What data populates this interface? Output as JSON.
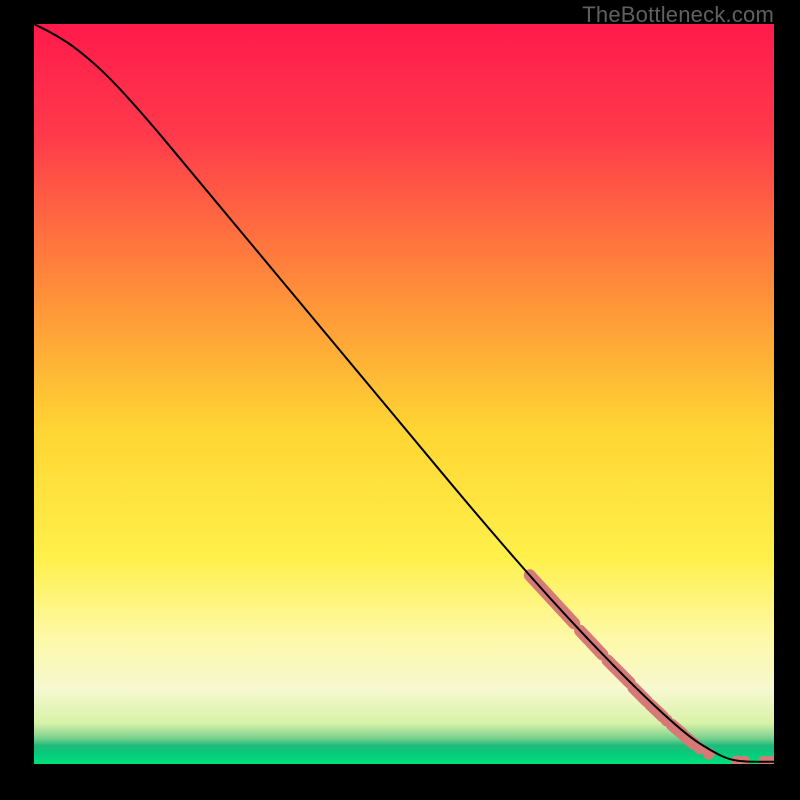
{
  "watermark": "TheBottleneck.com",
  "chart_data": {
    "type": "line",
    "title": "",
    "xlabel": "",
    "ylabel": "",
    "xlim": [
      0,
      100
    ],
    "ylim": [
      0,
      100
    ],
    "gradient_stops": [
      {
        "offset": 0.0,
        "color": "#ff1a4b"
      },
      {
        "offset": 0.15,
        "color": "#ff3a4b"
      },
      {
        "offset": 0.35,
        "color": "#ff8a3a"
      },
      {
        "offset": 0.55,
        "color": "#ffd633"
      },
      {
        "offset": 0.72,
        "color": "#fff04a"
      },
      {
        "offset": 0.83,
        "color": "#fdf9a8"
      },
      {
        "offset": 0.9,
        "color": "#f6f8d0"
      },
      {
        "offset": 0.945,
        "color": "#d8f2a8"
      },
      {
        "offset": 0.965,
        "color": "#7ad18f"
      },
      {
        "offset": 0.975,
        "color": "#1fba7a"
      },
      {
        "offset": 0.985,
        "color": "#08c97a"
      },
      {
        "offset": 1.0,
        "color": "#00e07a"
      }
    ],
    "curve": [
      {
        "x": 0,
        "y": 100
      },
      {
        "x": 3,
        "y": 98.5
      },
      {
        "x": 6,
        "y": 96.5
      },
      {
        "x": 10,
        "y": 93
      },
      {
        "x": 15,
        "y": 87.5
      },
      {
        "x": 20,
        "y": 81.5
      },
      {
        "x": 30,
        "y": 69.5
      },
      {
        "x": 40,
        "y": 57.5
      },
      {
        "x": 50,
        "y": 45.5
      },
      {
        "x": 60,
        "y": 33.5
      },
      {
        "x": 70,
        "y": 22.0
      },
      {
        "x": 80,
        "y": 11.5
      },
      {
        "x": 88,
        "y": 4.0
      },
      {
        "x": 92,
        "y": 1.5
      },
      {
        "x": 94,
        "y": 0.6
      },
      {
        "x": 96,
        "y": 0.3
      },
      {
        "x": 100,
        "y": 0.3
      }
    ],
    "highlight_segments": [
      {
        "x1": 67,
        "y1": 25.5,
        "x2": 73,
        "y2": 19.0
      },
      {
        "x1": 73.8,
        "y1": 18.0,
        "x2": 76.8,
        "y2": 14.8
      },
      {
        "x1": 77.5,
        "y1": 14.0,
        "x2": 80.5,
        "y2": 11.0
      },
      {
        "x1": 81.0,
        "y1": 10.3,
        "x2": 82.8,
        "y2": 8.5
      },
      {
        "x1": 83.3,
        "y1": 8.0,
        "x2": 85.0,
        "y2": 6.4
      },
      {
        "x1": 86.2,
        "y1": 5.3,
        "x2": 87.6,
        "y2": 4.1
      },
      {
        "x1": 88.0,
        "y1": 3.7,
        "x2": 89.2,
        "y2": 2.7
      }
    ],
    "highlight_dots": [
      {
        "x": 85.5,
        "y": 5.9
      },
      {
        "x": 90.0,
        "y": 2.1
      },
      {
        "x": 91.2,
        "y": 1.4
      },
      {
        "x": 95.0,
        "y": 0.35
      },
      {
        "x": 96.0,
        "y": 0.3
      },
      {
        "x": 98.7,
        "y": 0.3
      },
      {
        "x": 99.6,
        "y": 0.3
      }
    ],
    "highlight_color": "#d67a78",
    "curve_color": "#000000"
  }
}
